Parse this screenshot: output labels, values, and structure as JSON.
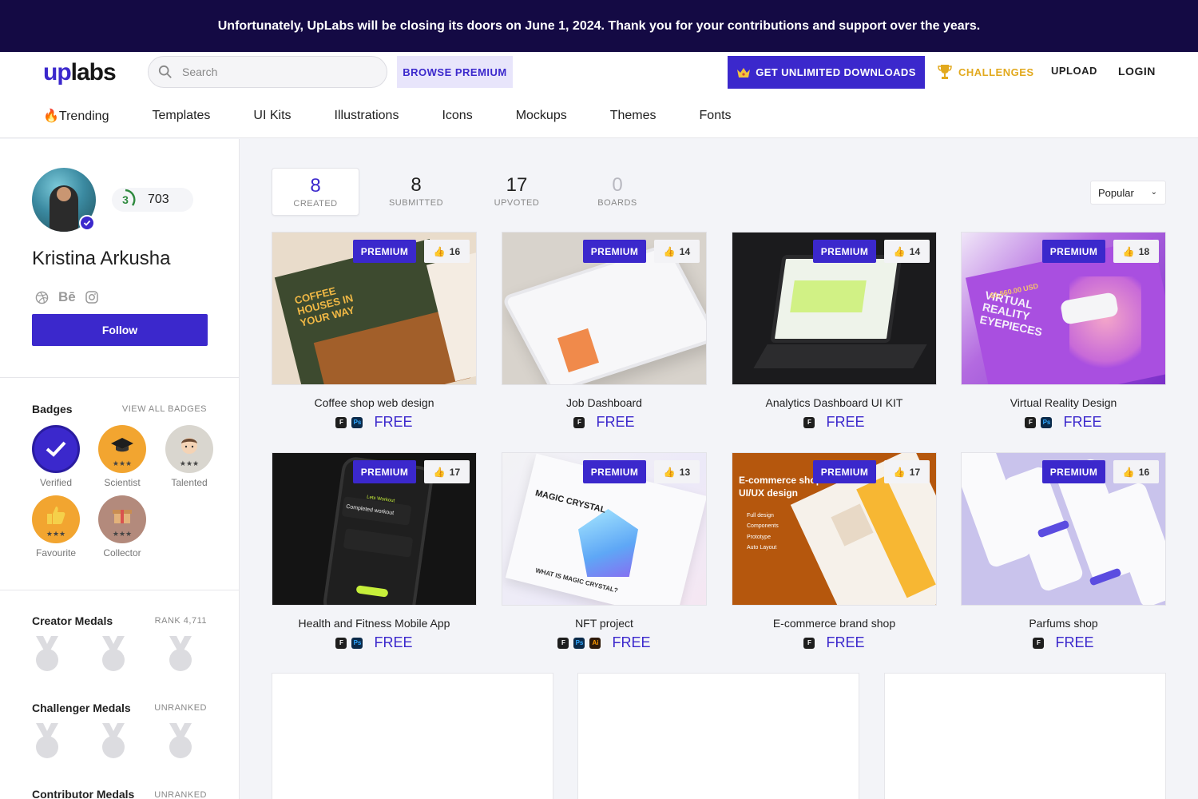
{
  "banner": {
    "text": "Unfortunately, UpLabs will be closing its doors on June 1, 2024. Thank you for your contributions and support over the years."
  },
  "header": {
    "logo": {
      "up": "up",
      "labs": "labs"
    },
    "search_placeholder": "Search",
    "browse_premium": "BROWSE PREMIUM",
    "unlimited_downloads": "GET UNLIMITED DOWNLOADS",
    "challenges": "CHALLENGES",
    "upload": "UPLOAD",
    "login": "LOGIN",
    "accent": "#3b28cc"
  },
  "nav": [
    {
      "label": "🔥Trending"
    },
    {
      "label": "Templates"
    },
    {
      "label": "UI Kits"
    },
    {
      "label": "Illustrations"
    },
    {
      "label": "Icons"
    },
    {
      "label": "Mockups"
    },
    {
      "label": "Themes"
    },
    {
      "label": "Fonts"
    }
  ],
  "profile": {
    "name": "Kristina Arkusha",
    "level": "3",
    "points": "703",
    "socials": [
      "dribbble-icon",
      "behance-icon",
      "instagram-icon"
    ],
    "behance_text": "Bē",
    "follow": "Follow"
  },
  "badges": {
    "title": "Badges",
    "view_all": "VIEW ALL BADGES",
    "items": [
      {
        "label": "Verified",
        "icon": "check-icon",
        "stars": ""
      },
      {
        "label": "Scientist",
        "icon": "graduation-cap-icon",
        "stars": "★★★"
      },
      {
        "label": "Talented",
        "icon": "face-icon",
        "stars": "★★★"
      },
      {
        "label": "Favourite",
        "icon": "thumbs-up-icon",
        "stars": "★★★"
      },
      {
        "label": "Collector",
        "icon": "box-icon",
        "stars": "★★★"
      }
    ]
  },
  "medals": {
    "creator": {
      "title": "Creator Medals",
      "meta": "RANK 4,711"
    },
    "challenger": {
      "title": "Challenger Medals",
      "meta": "UNRANKED"
    },
    "contributor": {
      "title": "Contributor Medals",
      "meta": "UNRANKED"
    }
  },
  "stats": [
    {
      "num": "8",
      "cap": "CREATED"
    },
    {
      "num": "8",
      "cap": "SUBMITTED"
    },
    {
      "num": "17",
      "cap": "UPVOTED"
    },
    {
      "num": "0",
      "cap": "BOARDS"
    }
  ],
  "sort": {
    "selected": "Popular"
  },
  "premium_label": "PREMIUM",
  "free_label": "FREE",
  "cards": [
    {
      "title": "Coffee shop web design",
      "likes": "16",
      "tools": [
        "figma",
        "ps"
      ]
    },
    {
      "title": "Job Dashboard",
      "likes": "14",
      "tools": [
        "figma"
      ]
    },
    {
      "title": "Analytics Dashboard UI KIT",
      "likes": "14",
      "tools": [
        "figma"
      ]
    },
    {
      "title": "Virtual Reality Design",
      "likes": "18",
      "tools": [
        "figma",
        "ps"
      ]
    },
    {
      "title": "Health and Fitness Mobile App",
      "likes": "17",
      "tools": [
        "figma",
        "ps"
      ]
    },
    {
      "title": "NFT project",
      "likes": "13",
      "tools": [
        "figma",
        "ps",
        "ai"
      ]
    },
    {
      "title": "E-commerce brand shop",
      "likes": "17",
      "tools": [
        "figma"
      ]
    },
    {
      "title": "Parfums shop",
      "likes": "16",
      "tools": [
        "figma"
      ]
    }
  ],
  "thumb_text": {
    "coffee": "COFFEE HOUSES IN YOUR WAY",
    "vr": "VIRTUAL REALITY EYEPIECES",
    "vr_price": "$1,560.00 USD",
    "nft": "MAGIC CRYSTAL",
    "nft_sub": "WHAT IS MAGIC CRYSTAL?",
    "ecom": "E-commerce shop UI/UX design",
    "ecom_list": [
      "Full design",
      "Components",
      "Prototype",
      "Auto Layout"
    ],
    "fitness_1": "Lets Workout",
    "fitness_2": "Completed workout"
  }
}
